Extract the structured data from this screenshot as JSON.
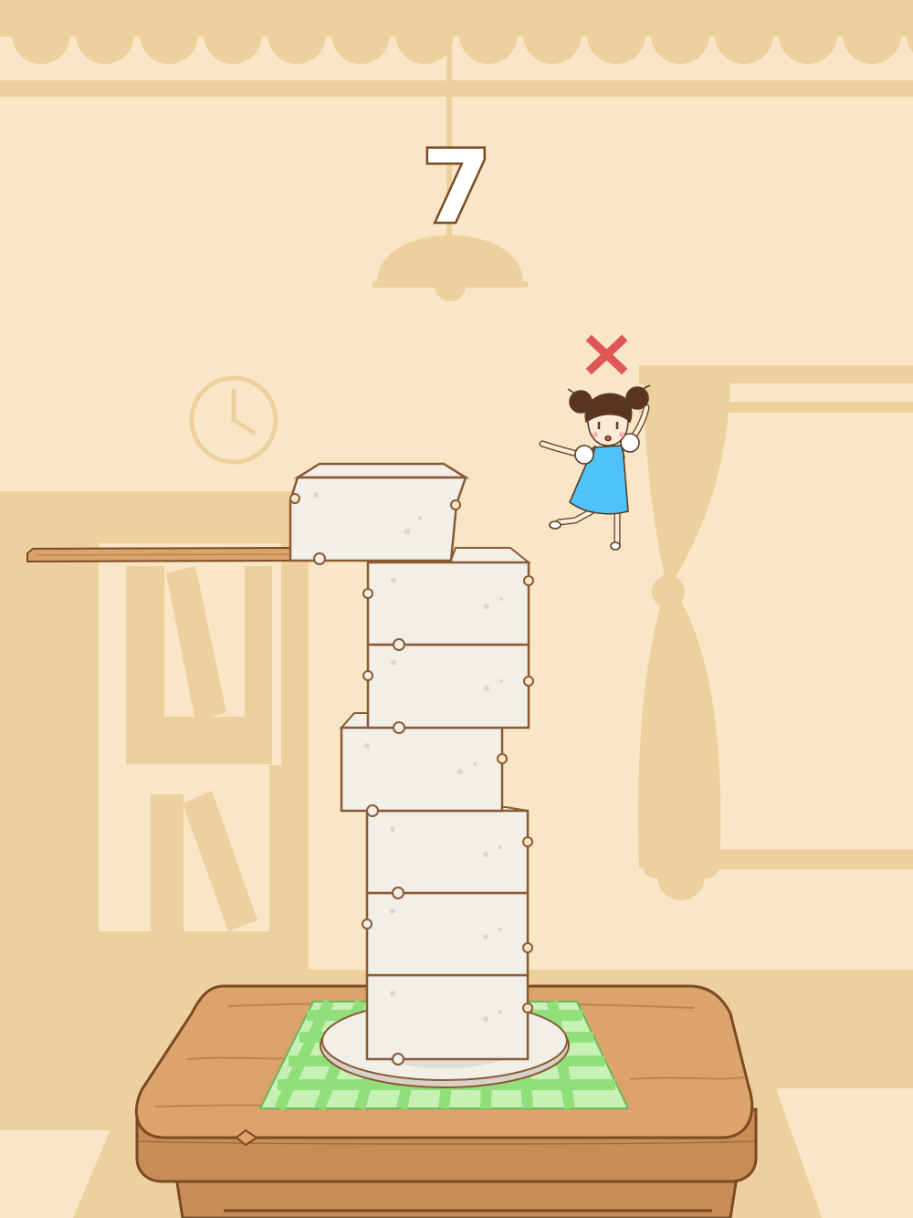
{
  "game": {
    "score": "7",
    "status": "fail",
    "stacked_blocks": 7,
    "status_icon": "red-x-icon",
    "item": "tofu-block",
    "character": "girl-in-blue-dress"
  },
  "colors": {
    "background": "#f8e6c6",
    "silhouette": "#eed09f",
    "tofu": "#f2eee8",
    "tofu_outline": "#8a5a32",
    "table": "#dca36b",
    "cloth_green": "#8fdf78",
    "fail_mark": "#e05555",
    "dress": "#4fc3f7"
  }
}
